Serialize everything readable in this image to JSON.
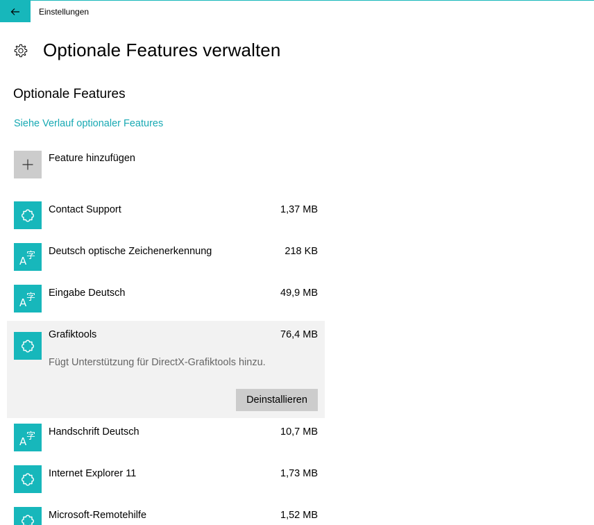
{
  "window": {
    "title": "Einstellungen"
  },
  "page": {
    "title": "Optionale Features verwalten"
  },
  "section": {
    "title": "Optionale Features",
    "history_link": "Siehe Verlauf optionaler Features",
    "add_feature": "Feature hinzufügen"
  },
  "features": [
    {
      "name": "Contact Support",
      "size": "1,37 MB",
      "icon": "puzzle-icon"
    },
    {
      "name": "Deutsch optische Zeichenerkennung",
      "size": "218 KB",
      "icon": "language-icon"
    },
    {
      "name": "Eingabe Deutsch",
      "size": "49,9 MB",
      "icon": "language-icon"
    },
    {
      "name": "Grafiktools",
      "size": "76,4 MB",
      "icon": "puzzle-icon",
      "expanded": true,
      "description": "Fügt Unterstützung für DirectX-Grafiktools hinzu.",
      "action": "Deinstallieren"
    },
    {
      "name": "Handschrift Deutsch",
      "size": "10,7 MB",
      "icon": "language-icon"
    },
    {
      "name": "Internet Explorer 11",
      "size": "1,73 MB",
      "icon": "puzzle-icon"
    },
    {
      "name": "Microsoft-Remotehilfe",
      "size": "1,52 MB",
      "icon": "puzzle-icon"
    }
  ],
  "colors": {
    "accent": "#17b7bb",
    "link": "#17a9b3",
    "tile_gray": "#cccccc",
    "selected_bg": "#f2f2f2"
  }
}
